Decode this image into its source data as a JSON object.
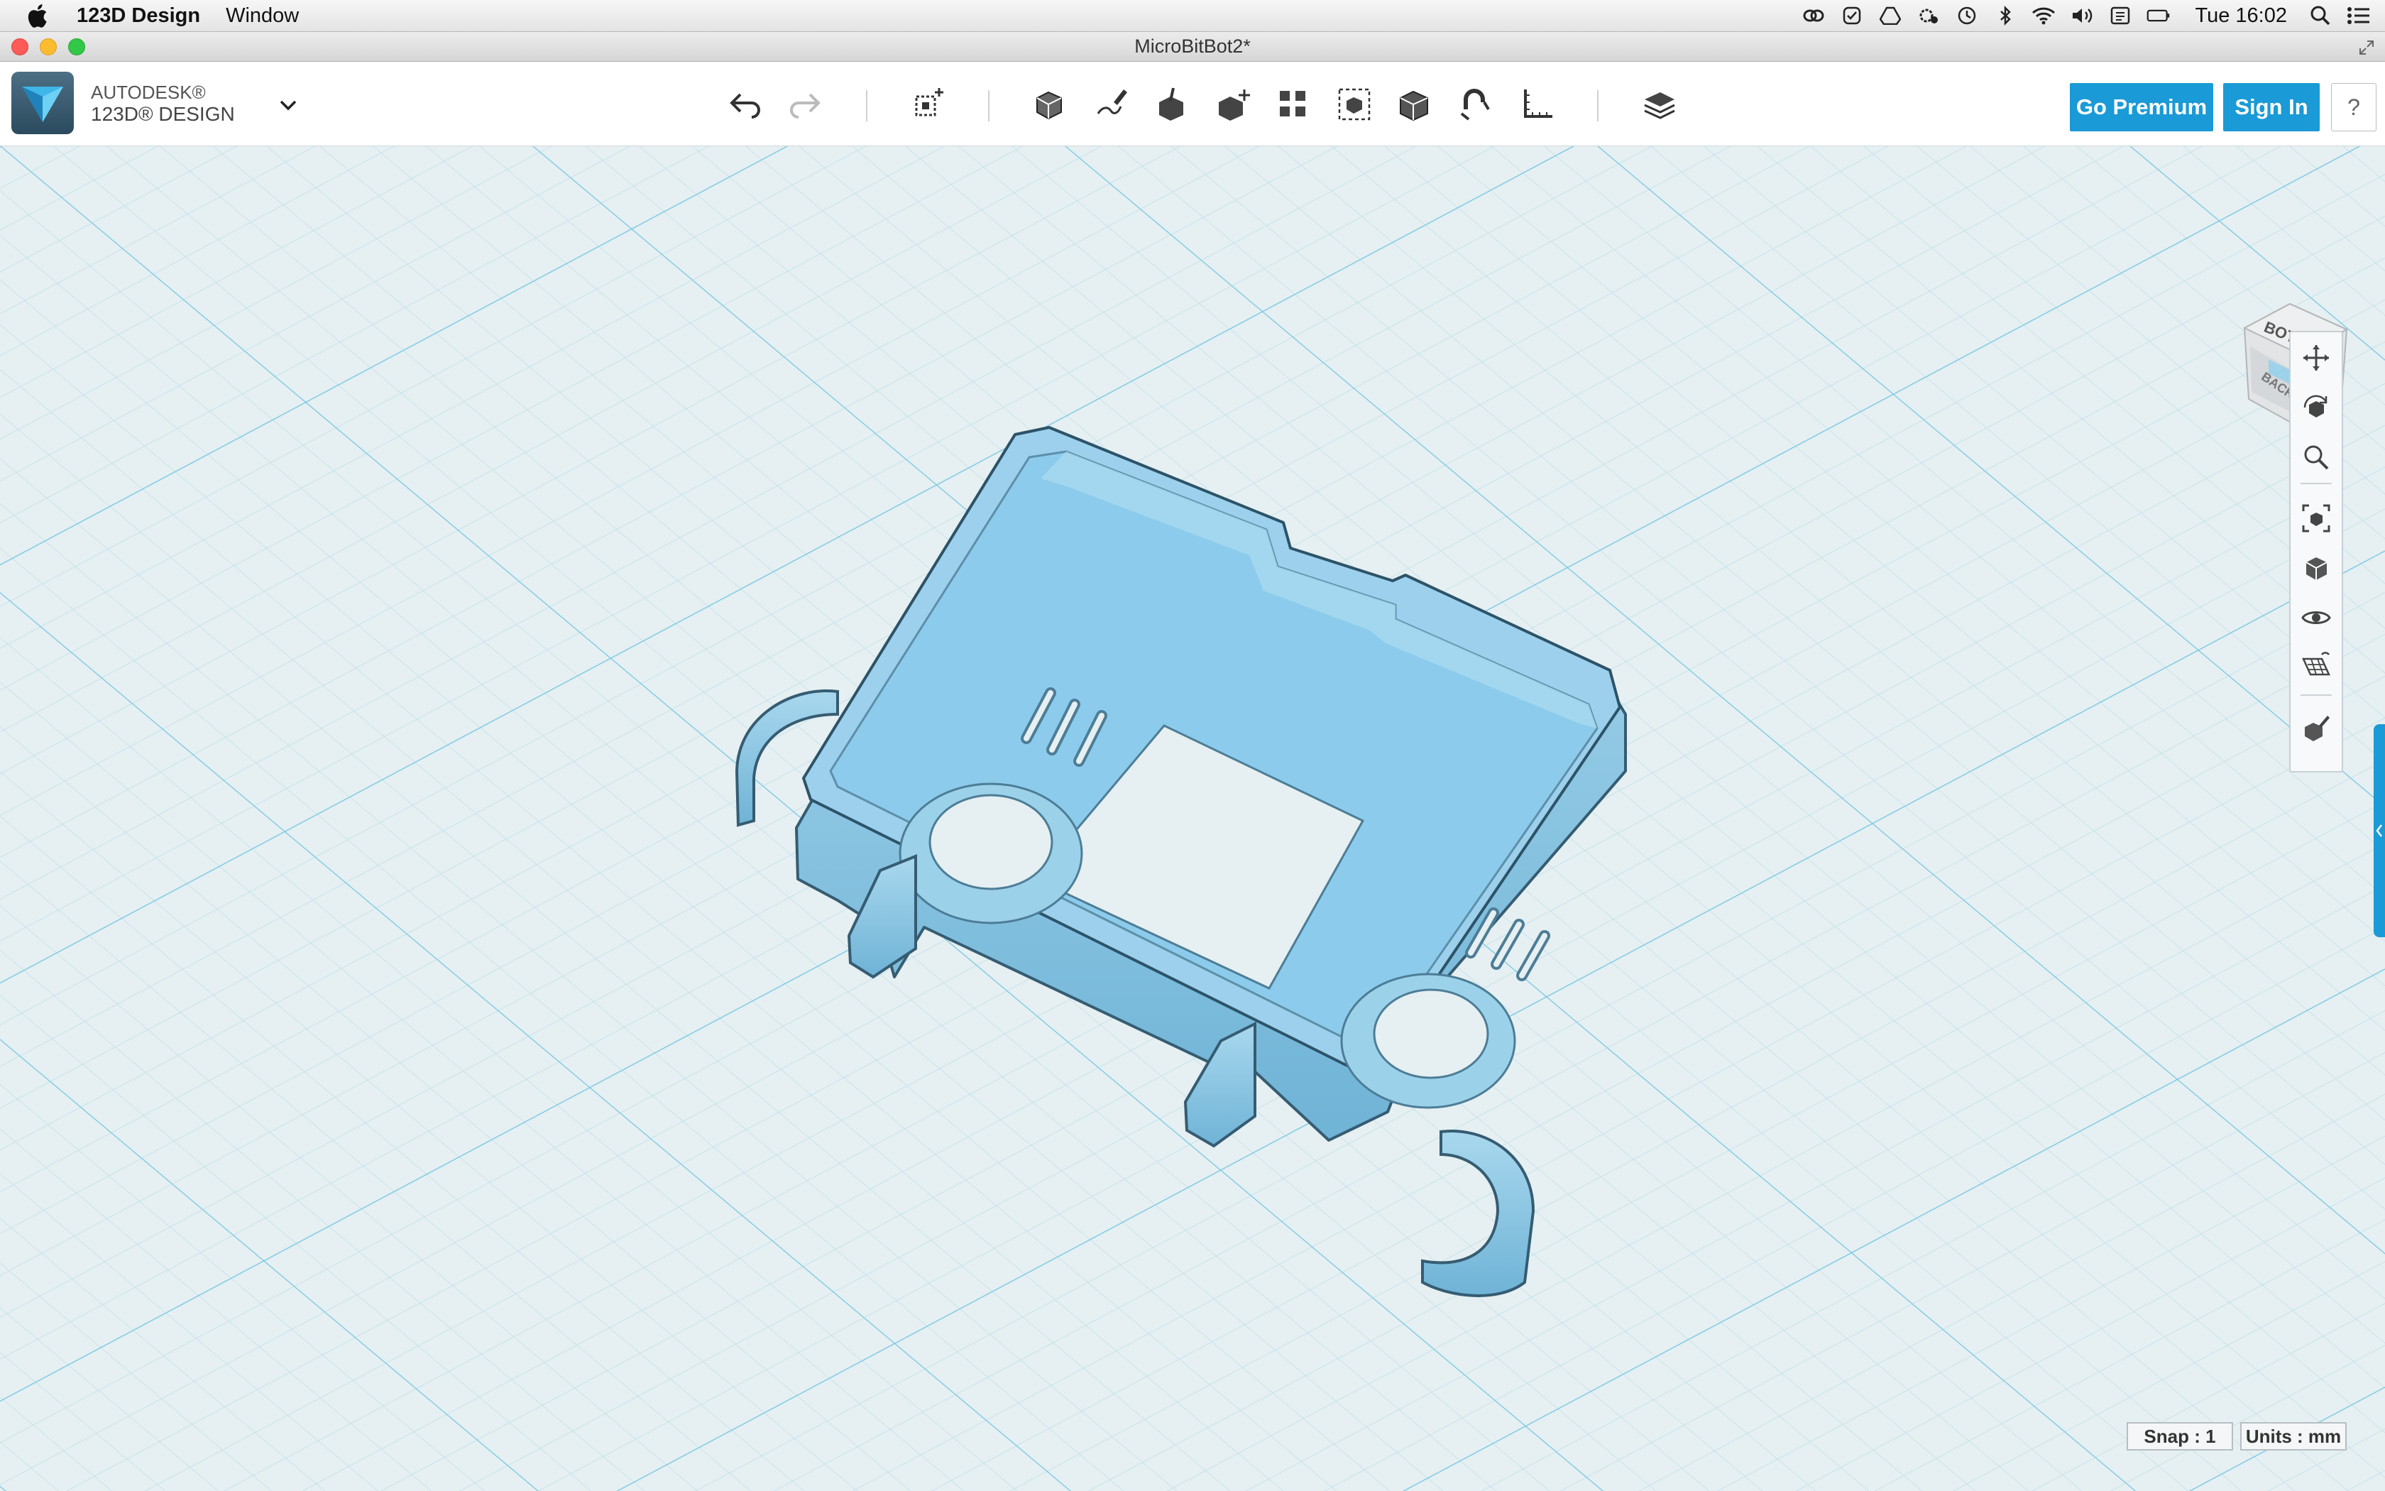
{
  "menubar": {
    "app_name": "123D Design",
    "window_menu": "Window",
    "clock": "Tue 16:02"
  },
  "window": {
    "title": "MicroBitBot2*"
  },
  "toolbar": {
    "brand_line1": "AUTODESK®",
    "brand_line2": "123D® DESIGN",
    "go_premium": "Go Premium",
    "sign_in": "Sign In",
    "help": "?"
  },
  "viewcube": {
    "top_face": "BOTTOM",
    "front_face": "BACK"
  },
  "status": {
    "snap": "Snap : 1",
    "units": "Units : mm"
  },
  "colors": {
    "accent": "#1a9ad6",
    "model": "#8cc7e6",
    "grid_bg": "#e6eff1"
  }
}
